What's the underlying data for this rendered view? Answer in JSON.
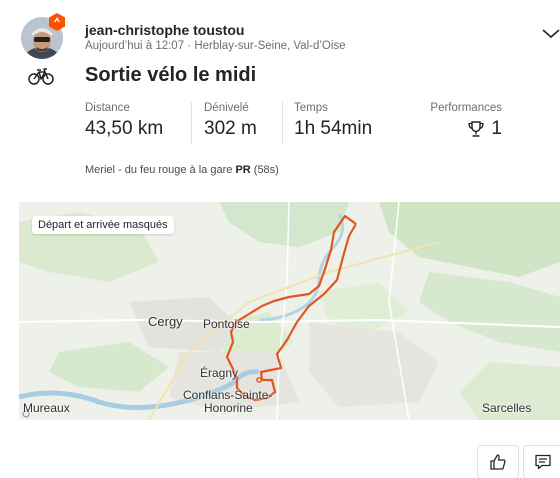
{
  "athlete": {
    "name": "jean-christophe toustou",
    "meta": "Aujourd’hui à 12:07 · Herblay-sur-Seine, Val-d’Oise"
  },
  "activity": {
    "sport_icon": "bike-icon",
    "title": "Sortie vélo le midi"
  },
  "stats": [
    {
      "label": "Distance",
      "value": "43,50 km"
    },
    {
      "label": "Dénivelé",
      "value": "302 m"
    },
    {
      "label": "Temps",
      "value": "1h 54min"
    }
  ],
  "performances": {
    "label": "Performances",
    "icon": "trophy-icon",
    "value": "1"
  },
  "segment": {
    "name": "Meriel - du feu rouge à la gare",
    "badge": "PR",
    "time": "(58s)"
  },
  "map": {
    "note": "Départ et arrivée masqués",
    "route_color": "#e0561f",
    "labels": {
      "cergy": "Cergy",
      "pontoise": "Pontoise",
      "eragny": "Éragny",
      "conflans_1": "Conflans-Sainte-",
      "conflans_2": "Honorine",
      "mureaux": "Mureaux",
      "sarcelles": "Sarcelles"
    }
  },
  "actions": {
    "kudos_icon": "thumbs-up-icon",
    "comment_icon": "comment-icon",
    "menu_icon": "chevron-down-icon"
  },
  "colors": {
    "brand": "#fc5200",
    "text": "#242428",
    "muted": "#6d6d78"
  }
}
